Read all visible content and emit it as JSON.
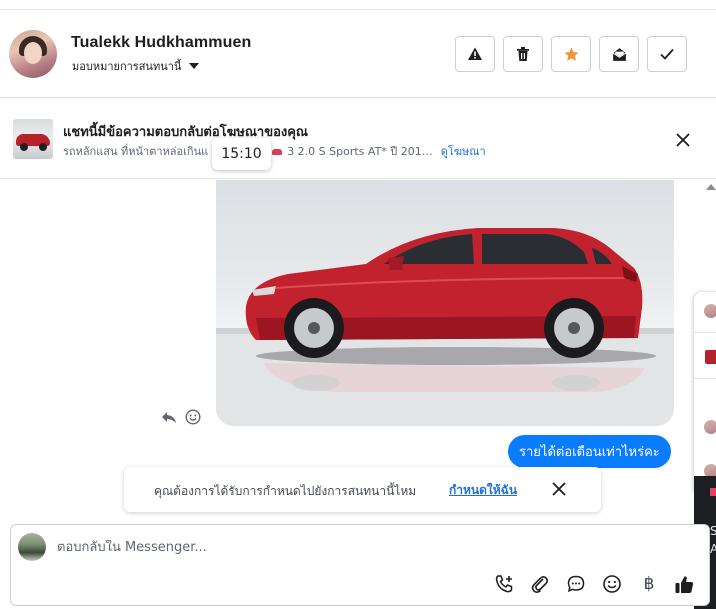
{
  "header": {
    "contact_name": "Tualekk Hudkhammuen",
    "assign_label": "มอบหมายการสนทนานี้",
    "actions": [
      "report-icon",
      "trash-icon",
      "star-icon",
      "mark-unread-icon",
      "done-check-icon"
    ],
    "star_color": "#f7923b"
  },
  "banner": {
    "title": "แชทนี้มีข้อความตอบกลับต่อโฆษณาของคุณ",
    "subtitle_left": "รถหลักแสน ที่หน้าตาหล่อเกินแ",
    "subtitle_right": "3 2.0 S Sports AT* ปี 201…",
    "view_ad_label": "ดูโฆษณา",
    "time_tooltip": "15:10"
  },
  "conversation": {
    "image_alt": "Red hatchback car photo",
    "outgoing_bubble": "รายได้ต่อเดือนเท่าไหร่คะ",
    "bubble_color": "#0a7cff"
  },
  "assign_prompt": {
    "text": "คุณต้องการได้รับการกำหนดไปยังการสนทนานี้ไหม",
    "link": "กำหนดให้ฉัน"
  },
  "side_panel": {
    "dark_text_1": "S",
    "dark_text_2": "A"
  },
  "composer": {
    "placeholder": "ตอบกลับใน Messenger...",
    "tools": [
      "call-add-icon",
      "attachment-icon",
      "saved-reply-icon",
      "emoji-icon",
      "baht-icon",
      "like-icon"
    ],
    "baht_symbol": "฿"
  }
}
